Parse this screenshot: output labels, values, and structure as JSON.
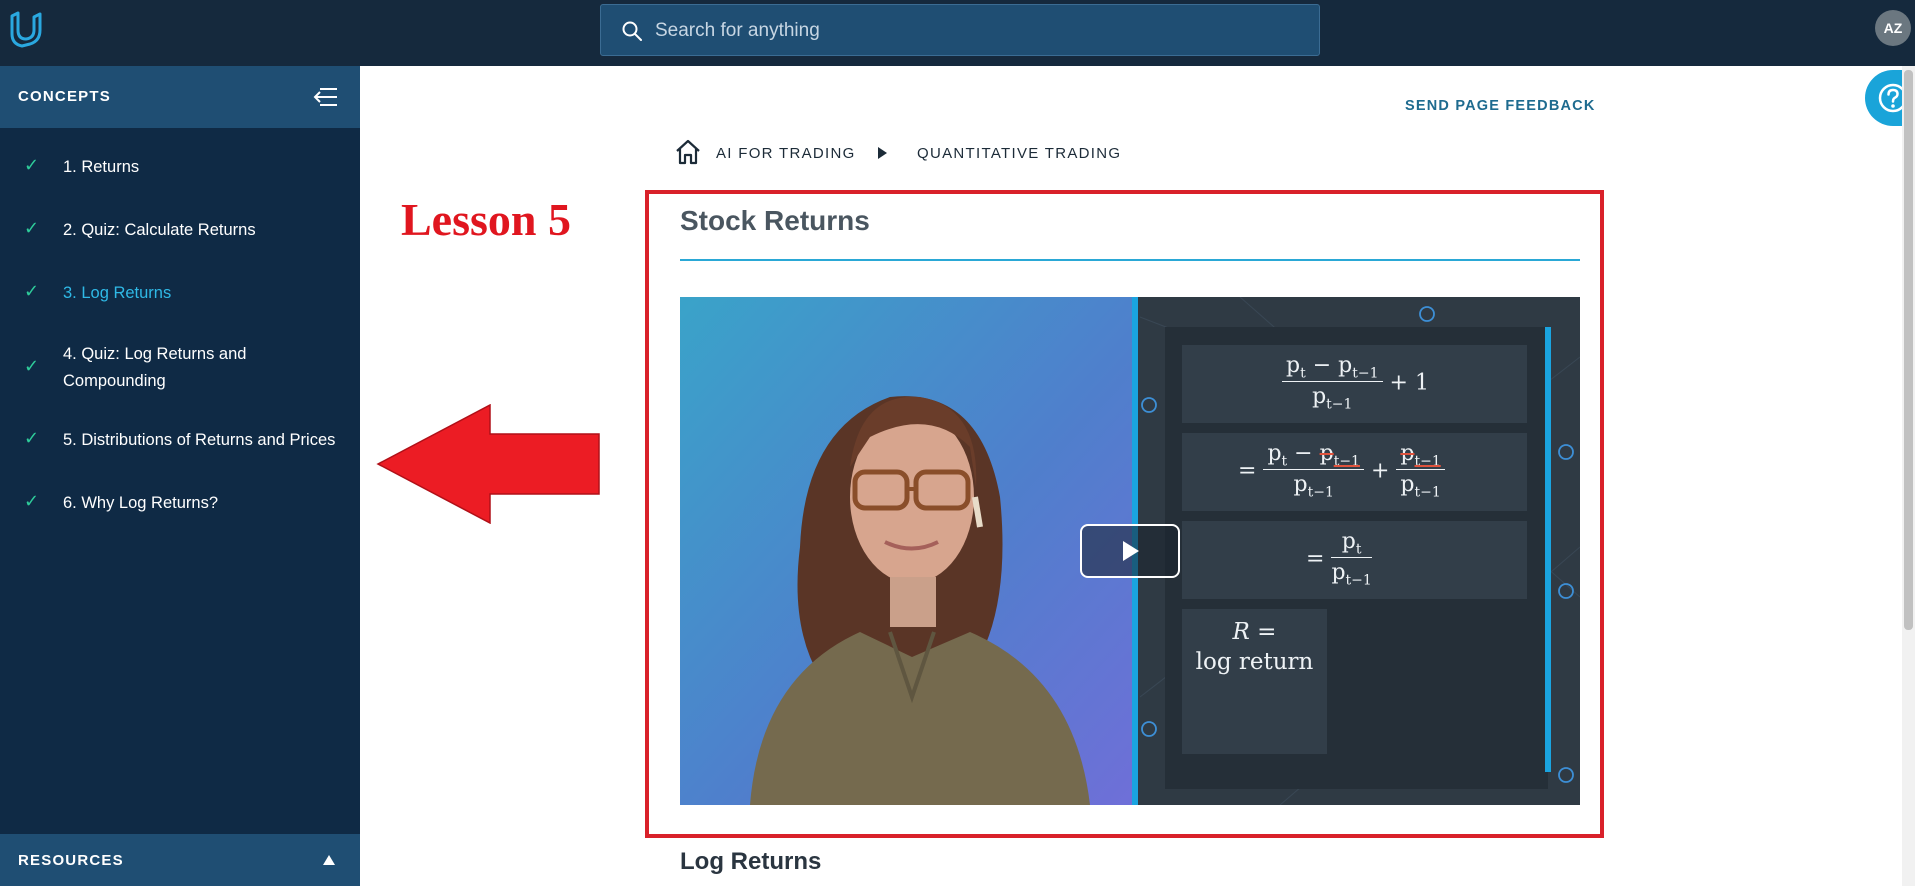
{
  "header": {
    "logo": "udacity-logo-icon",
    "search": {
      "placeholder": "Search for anything",
      "icon": "search-icon"
    },
    "avatar_initials": "AZ"
  },
  "sidebar": {
    "title": "CONCEPTS",
    "collapse_icon": "collapse-sidebar-icon",
    "items": [
      {
        "label": "1. Returns",
        "status": "complete"
      },
      {
        "label": "2. Quiz: Calculate Returns",
        "status": "complete"
      },
      {
        "label": "3. Log Returns",
        "status": "complete",
        "active": true
      },
      {
        "label": "4. Quiz: Log Returns and Compounding",
        "status": "complete"
      },
      {
        "label": "5. Distributions of Returns and Prices",
        "status": "complete"
      },
      {
        "label": "6. Why Log Returns?",
        "status": "complete"
      }
    ],
    "check_symbol": "✓",
    "resources_label": "RESOURCES"
  },
  "main": {
    "feedback_link": "SEND PAGE FEEDBACK",
    "breadcrumbs": [
      "AI FOR TRADING",
      "QUANTITATIVE TRADING"
    ],
    "annotation_label": "Lesson 5",
    "concept_title": "Stock Returns",
    "video": {
      "equations": [
        "p_t - p_{t-1} / p_{t-1} + 1",
        "= p_t - p_{t-1} / p_{t-1} + p_{t-1} / p_{t-1}",
        "= p_t / p_{t-1}",
        "R = log return"
      ],
      "box_text": {
        "line1": "R =",
        "line2": "log return"
      }
    },
    "section_heading": "Log Returns"
  },
  "colors": {
    "topbar": "#15293d",
    "sidebar": "#0f2a45",
    "sidebar_header": "#1f4e73",
    "accent": "#2fb9e6",
    "check": "#2ecc9a",
    "annotation_red": "#e0161f"
  }
}
